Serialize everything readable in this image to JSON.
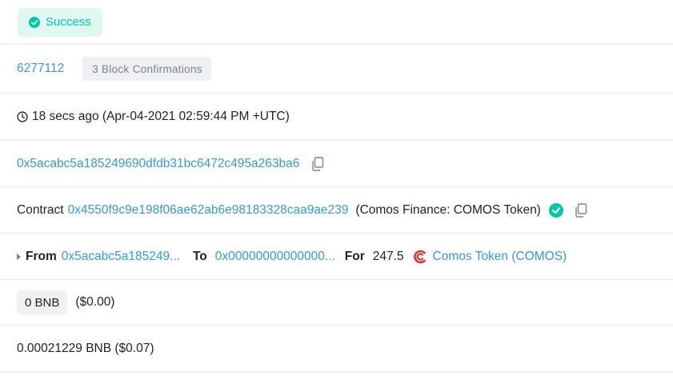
{
  "status": {
    "label": "Success",
    "color": "#00c9a7",
    "icon": "check-circle-icon"
  },
  "block": {
    "number": "6277112",
    "confirmations": "3 Block Confirmations"
  },
  "timestamp": {
    "icon": "clock-icon",
    "text": "18 secs ago (Apr-04-2021 02:59:44 PM +UTC)"
  },
  "from_address": {
    "value": "0x5acabc5a185249690dfdb31bc6472c495a263ba6",
    "copy_icon": "copy-icon"
  },
  "interacted_with": {
    "prefix": "Contract",
    "address": "0x4550f9c9e198f06ae62ab6e98183328caa9ae239",
    "name": "(Comos Finance: COMOS Token)",
    "verified_icon": "check-circle-icon",
    "copy_icon": "copy-icon"
  },
  "token_transfer": {
    "from_label": "From",
    "from_value": "0x5acabc5a185249...",
    "to_label": "To",
    "to_value": "0x00000000000000...",
    "for_label": "For",
    "amount": "247.5",
    "token_icon": "comos-logo-icon",
    "token_name": "Comos Token (COMOS)",
    "token_color": "#e03030"
  },
  "value": {
    "amount": "0 BNB",
    "usd": "($0.00)"
  },
  "fee": {
    "text": "0.00021229 BNB ($0.07)"
  },
  "colors": {
    "link": "#3498db",
    "success": "#00c9a7",
    "border": "#e7eaf3"
  }
}
